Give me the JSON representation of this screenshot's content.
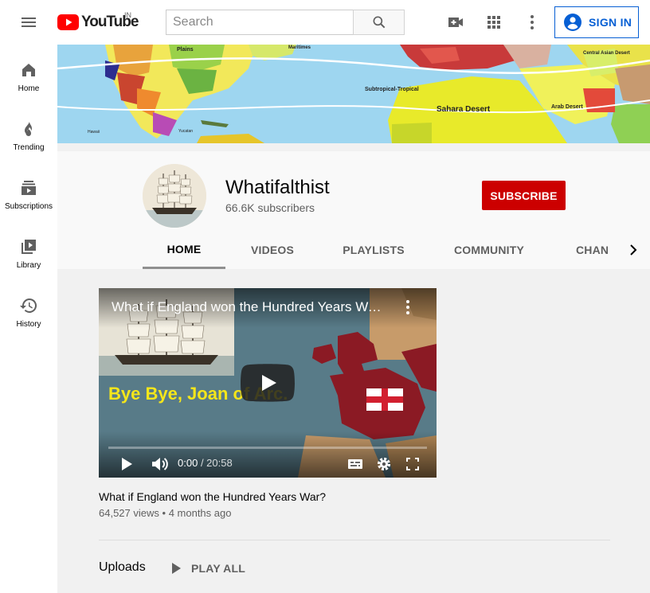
{
  "masthead": {
    "logo_text": "YouTube",
    "country": "IN",
    "search_placeholder": "Search",
    "sign_in": "SIGN IN"
  },
  "guide": {
    "items": [
      {
        "label": "Home",
        "icon": "home-icon"
      },
      {
        "label": "Trending",
        "icon": "fire-icon"
      },
      {
        "label": "Subscriptions",
        "icon": "subscriptions-icon"
      },
      {
        "label": "Library",
        "icon": "library-icon"
      },
      {
        "label": "History",
        "icon": "history-icon"
      }
    ]
  },
  "banner": {
    "labels": [
      "Plains",
      "Maritimes",
      "Subtropical-Tropical",
      "Sahara Desert",
      "Arab Desert",
      "Central Asian Desert",
      "Hawaii",
      "Yucatan"
    ]
  },
  "channel": {
    "name": "Whatifalthist",
    "subscribers": "66.6K subscribers",
    "subscribe_label": "SUBSCRIBE",
    "tabs": [
      "HOME",
      "VIDEOS",
      "PLAYLISTS",
      "COMMUNITY",
      "CHAN"
    ]
  },
  "featured_video": {
    "player_title": "What if England won the Hundred Years War?",
    "overlay_text": "Bye Bye, Joan of Arc.",
    "time_current": "0:00",
    "time_total": "20:58",
    "title": "What if England won the Hundred Years War?",
    "views": "64,527 views",
    "age": "4 months ago"
  },
  "uploads": {
    "label": "Uploads",
    "play_all": "PLAY ALL"
  },
  "colors": {
    "brand_red": "#cc0000",
    "link_blue": "#065fd4"
  }
}
